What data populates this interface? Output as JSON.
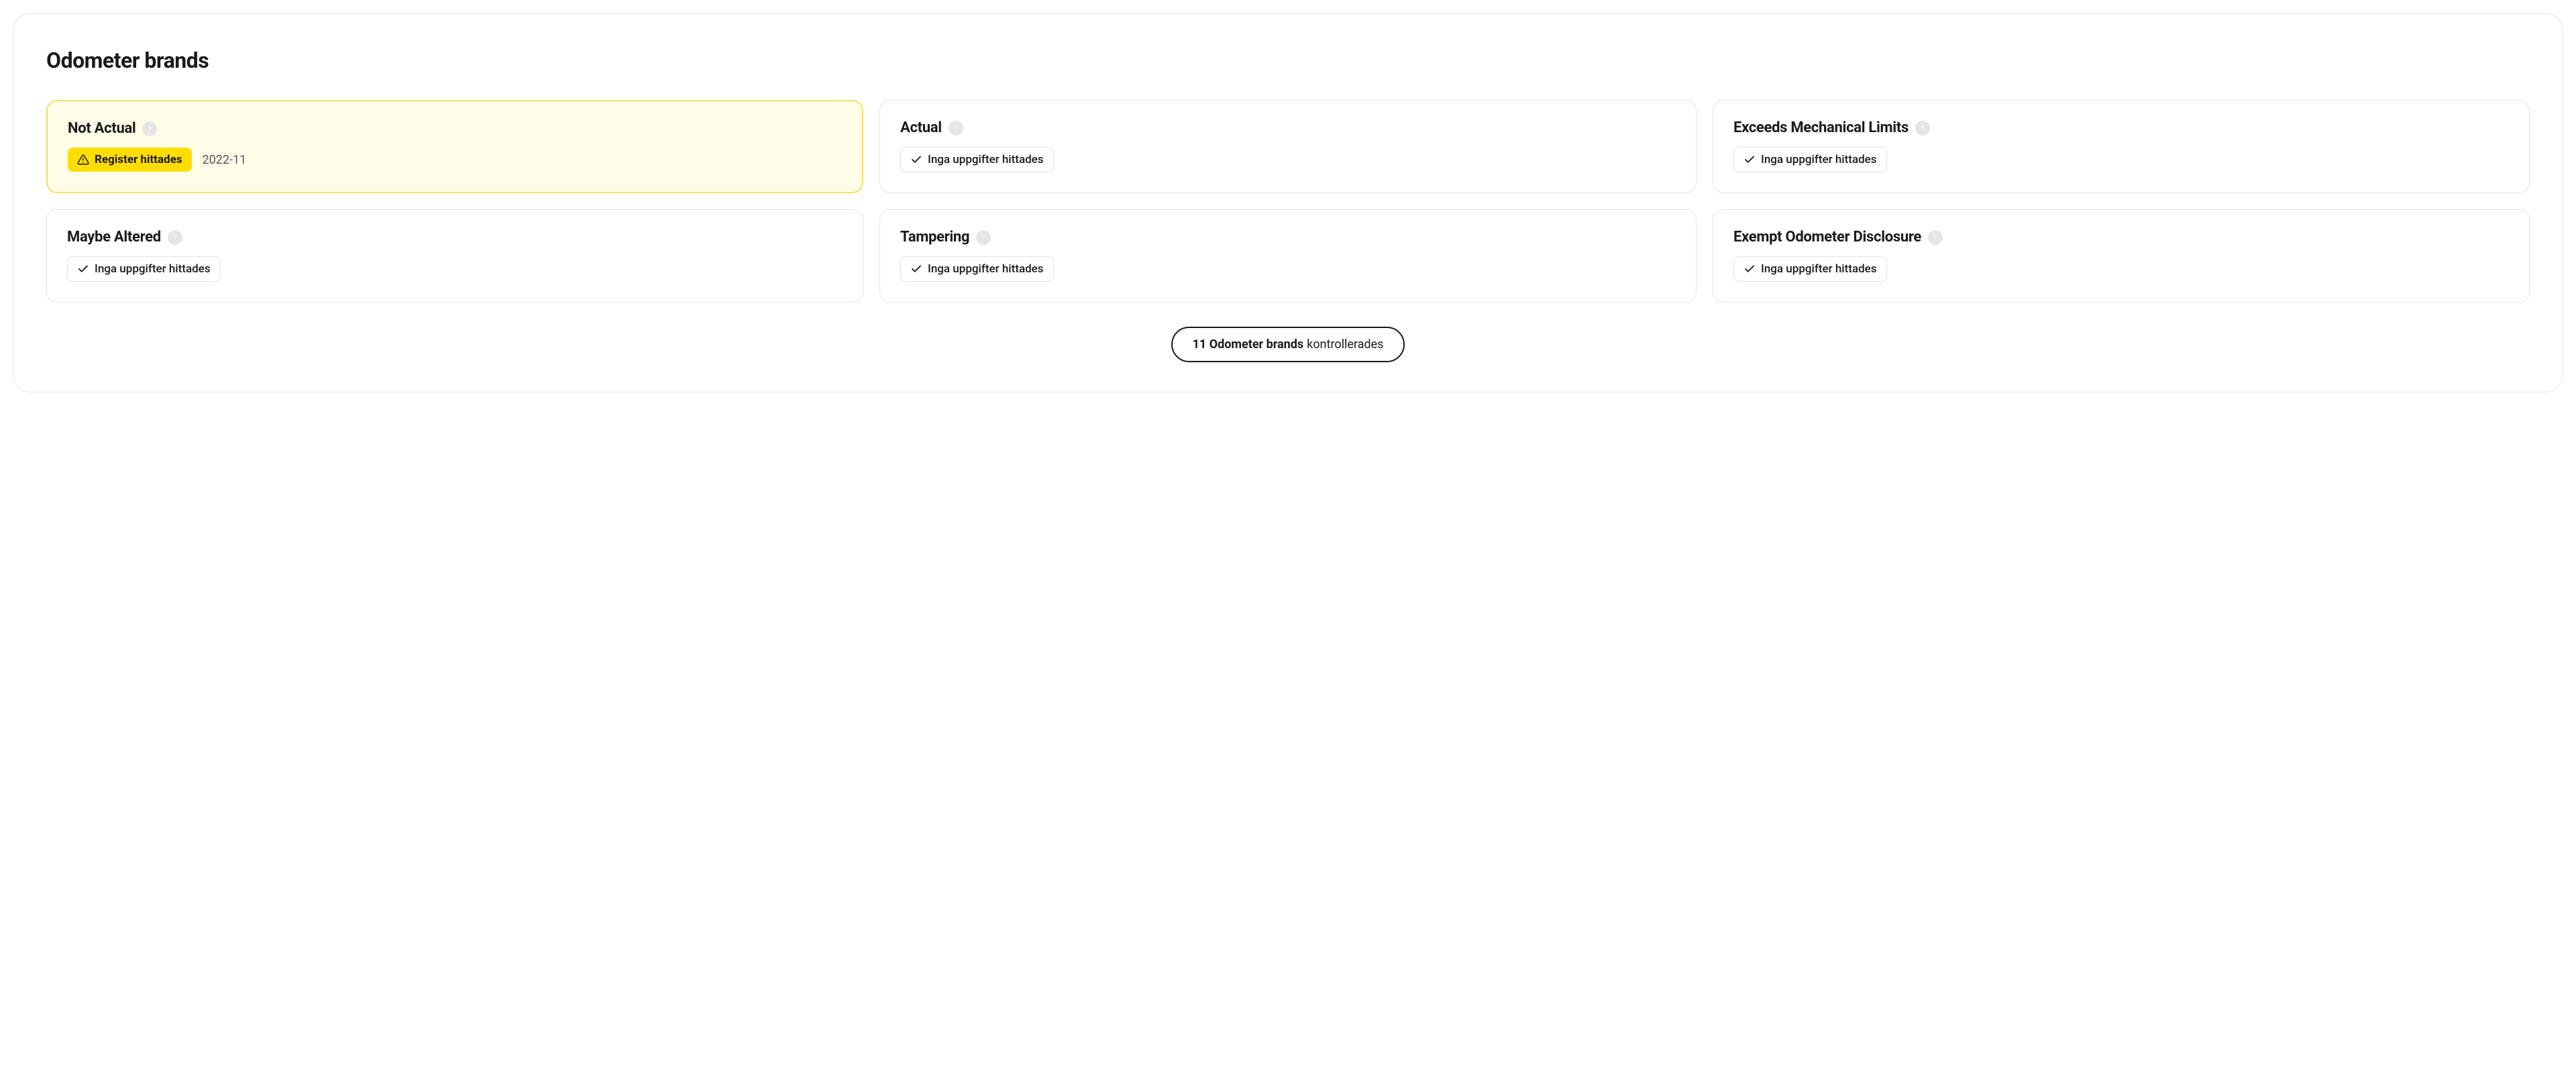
{
  "section_title": "Odometer brands",
  "cards": [
    {
      "title": "Not Actual",
      "highlighted": true,
      "badge_type": "warning",
      "badge_text": "Register hittades",
      "date": "2022-11"
    },
    {
      "title": "Actual",
      "highlighted": false,
      "badge_type": "neutral",
      "badge_text": "Inga uppgifter hittades",
      "date": ""
    },
    {
      "title": "Exceeds Mechanical Limits",
      "highlighted": false,
      "badge_type": "neutral",
      "badge_text": "Inga uppgifter hittades",
      "date": ""
    },
    {
      "title": "Maybe Altered",
      "highlighted": false,
      "badge_type": "neutral",
      "badge_text": "Inga uppgifter hittades",
      "date": ""
    },
    {
      "title": "Tampering",
      "highlighted": false,
      "badge_type": "neutral",
      "badge_text": "Inga uppgifter hittades",
      "date": ""
    },
    {
      "title": "Exempt Odometer Disclosure",
      "highlighted": false,
      "badge_type": "neutral",
      "badge_text": "Inga uppgifter hittades",
      "date": ""
    }
  ],
  "footer": {
    "bold": "11 Odometer brands",
    "rest": "kontrollerades"
  }
}
